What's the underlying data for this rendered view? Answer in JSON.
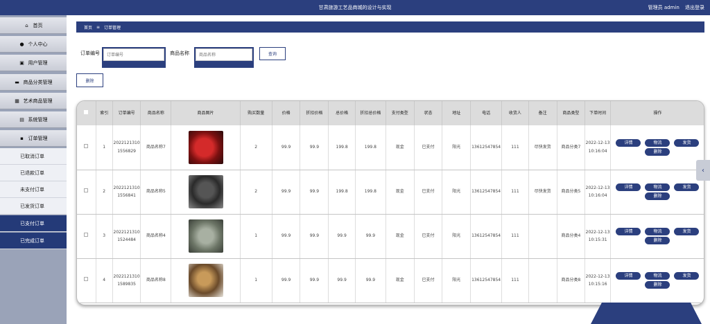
{
  "header": {
    "title": "甘肃旅游工艺品商城的设计与实现",
    "user_label": "管理员 admin",
    "logout_label": "退出登录"
  },
  "sidebar": {
    "items": [
      {
        "label": "首页",
        "icon": "home-icon"
      },
      {
        "label": "个人中心",
        "icon": "person-icon"
      },
      {
        "label": "用户管理",
        "icon": "user-manage-icon"
      },
      {
        "label": "商品分类管理",
        "icon": "category-icon"
      },
      {
        "label": "艺术商品管理",
        "icon": "grid-icon"
      },
      {
        "label": "系统管理",
        "icon": "system-icon"
      },
      {
        "label": "订单管理",
        "icon": "order-icon"
      }
    ],
    "sub_items": [
      {
        "label": "已取消订单",
        "active": false
      },
      {
        "label": "已退款订单",
        "active": false
      },
      {
        "label": "未支付订单",
        "active": false
      },
      {
        "label": "已发货订单",
        "active": false
      },
      {
        "label": "已支付订单",
        "active": true
      },
      {
        "label": "已完成订单",
        "active": true
      }
    ]
  },
  "breadcrumb": {
    "home": "首页",
    "sep": "≡",
    "current": "订单管理"
  },
  "search": {
    "order_no_label": "订单编号",
    "order_no_placeholder": "订单编号",
    "product_name_label": "商品名称",
    "product_name_placeholder": "商品名称",
    "query_button": "查询",
    "delete_button": "删除"
  },
  "table": {
    "headers": [
      "索引",
      "订单编号",
      "商品名称",
      "商品图片",
      "购买数量",
      "价格",
      "折扣价格",
      "总价格",
      "折扣总价格",
      "支付类型",
      "状态",
      "地址",
      "电话",
      "收货人",
      "备注",
      "商品类型",
      "下单时间",
      "操作"
    ],
    "rows": [
      {
        "index": "1",
        "order_no": "20221213101556829",
        "product": "商品名称7",
        "qty": "2",
        "price": "99.9",
        "discount": "99.9",
        "total": "199.8",
        "discount_total": "199.8",
        "pay": "现金",
        "status": "已支付",
        "address": "阳光",
        "phone": "13612547854",
        "receiver": "111",
        "remark": "尽快发货",
        "category": "商品分类7",
        "time": "2022-12-13 10:16:04"
      },
      {
        "index": "2",
        "order_no": "20221213101556841",
        "product": "商品名称5",
        "qty": "2",
        "price": "99.9",
        "discount": "99.9",
        "total": "199.8",
        "discount_total": "199.8",
        "pay": "现金",
        "status": "已支付",
        "address": "阳光",
        "phone": "13612547854",
        "receiver": "111",
        "remark": "尽快发货",
        "category": "商品分类5",
        "time": "2022-12-13 10:16:04"
      },
      {
        "index": "3",
        "order_no": "20221213101524484",
        "product": "商品名称4",
        "qty": "1",
        "price": "99.9",
        "discount": "99.9",
        "total": "99.9",
        "discount_total": "99.9",
        "pay": "现金",
        "status": "已支付",
        "address": "阳光",
        "phone": "13612547854",
        "receiver": "111",
        "remark": "",
        "category": "商品分类4",
        "time": "2022-12-13 10:15:31"
      },
      {
        "index": "4",
        "order_no": "20221213101589835",
        "product": "商品名称8",
        "qty": "1",
        "price": "99.9",
        "discount": "99.9",
        "total": "99.9",
        "discount_total": "99.9",
        "pay": "现金",
        "status": "已支付",
        "address": "阳光",
        "phone": "13612547854",
        "receiver": "111",
        "remark": "",
        "category": "商品分类8",
        "time": "2022-12-13 10:15:16"
      }
    ],
    "actions": {
      "detail": "详情",
      "logistics": "物流",
      "ship": "发货",
      "delete": "删除"
    }
  },
  "colors": {
    "primary": "#2b3f7e",
    "sidebar_bg": "#9aa3b8",
    "header_bg": "#dcdcdc"
  }
}
